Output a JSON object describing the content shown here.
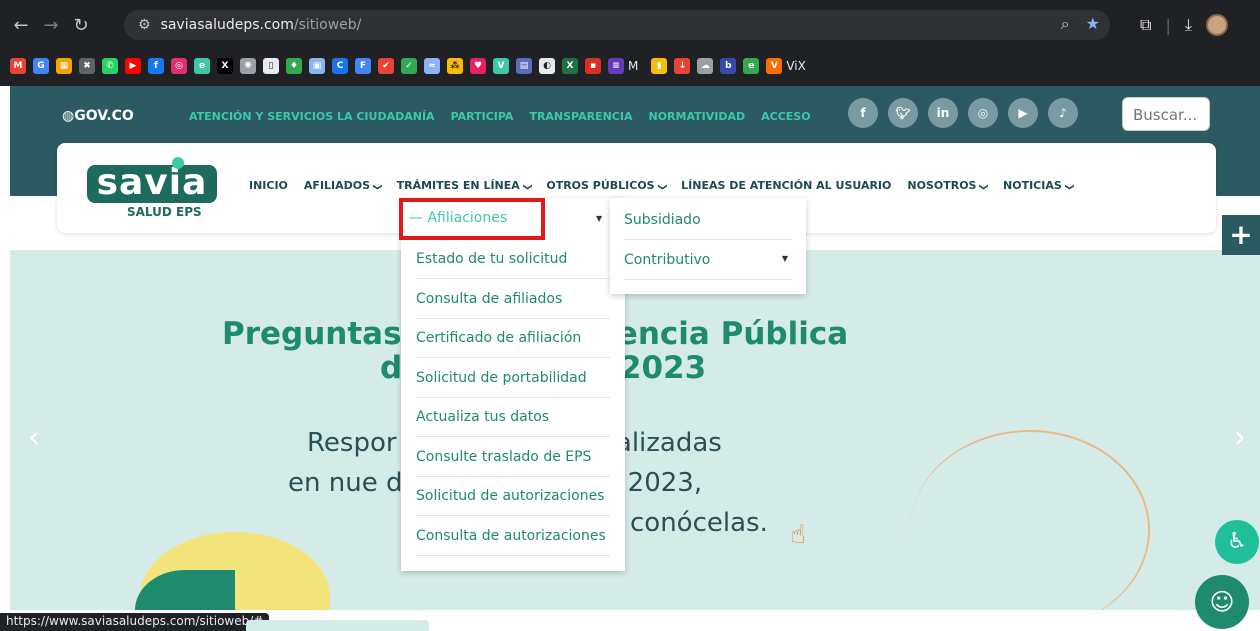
{
  "browser": {
    "url_domain": "saviasaludeps.com",
    "url_path": "/sitioweb/",
    "status_url": "https://www.saviasaludeps.com/sitioweb/#",
    "bookmarks": [
      {
        "icon": "gmail-icon",
        "color": "#ea4335",
        "glyph": "M"
      },
      {
        "icon": "google-icon",
        "color": "#4285f4",
        "glyph": "G"
      },
      {
        "icon": "grid-app-icon",
        "color": "#f4a300",
        "glyph": "▦"
      },
      {
        "icon": "x-app-icon",
        "color": "#5f6368",
        "glyph": "✖"
      },
      {
        "icon": "whatsapp-icon",
        "color": "#25d366",
        "glyph": "✆"
      },
      {
        "icon": "youtube-icon",
        "color": "#ff0000",
        "glyph": "▶"
      },
      {
        "icon": "facebook-icon",
        "color": "#1877f2",
        "glyph": "f"
      },
      {
        "icon": "instagram-icon",
        "color": "#e1306c",
        "glyph": "◎"
      },
      {
        "icon": "e-app-icon",
        "color": "#3ec8a8",
        "glyph": "e"
      },
      {
        "icon": "twitter-x-icon",
        "color": "#000000",
        "glyph": "X"
      },
      {
        "icon": "gear-app-icon",
        "color": "#9aa0a6",
        "glyph": "✺"
      },
      {
        "icon": "doc-icon",
        "color": "#e8eaed",
        "glyph": "▯"
      },
      {
        "icon": "map-pin-icon",
        "color": "#34a853",
        "glyph": "♦"
      },
      {
        "icon": "photo-icon",
        "color": "#8ab4f8",
        "glyph": "▣"
      },
      {
        "icon": "c-app-icon",
        "color": "#1a73e8",
        "glyph": "C"
      },
      {
        "icon": "form-icon",
        "color": "#4285f4",
        "glyph": "F"
      },
      {
        "icon": "check-icon",
        "color": "#ea4335",
        "glyph": "✔"
      },
      {
        "icon": "tick-icon",
        "color": "#34a853",
        "glyph": "✓"
      },
      {
        "icon": "wave-icon",
        "color": "#8ab4f8",
        "glyph": "≈"
      },
      {
        "icon": "dots-app-icon",
        "color": "#fbbc04",
        "glyph": "⁂"
      },
      {
        "icon": "heart-icon",
        "color": "#e91e63",
        "glyph": "♥"
      },
      {
        "icon": "v-app-icon",
        "color": "#3ec8a8",
        "glyph": "V"
      },
      {
        "icon": "calendar-icon",
        "color": "#5c6bc0",
        "glyph": "▤"
      },
      {
        "icon": "globe-icon",
        "color": "#e8eaed",
        "glyph": "◐"
      },
      {
        "icon": "excel-icon",
        "color": "#1e7145",
        "glyph": "X"
      },
      {
        "icon": "red-app-icon",
        "color": "#d93025",
        "glyph": "▪"
      },
      {
        "icon": "list-app-icon",
        "color": "#673ab7",
        "glyph": "≡"
      }
    ],
    "bookmark_label_m": "M",
    "bookmark_label_vix": "ViX",
    "bookmarks2": [
      {
        "icon": "bars-chart-icon",
        "color": "#fbbc04",
        "glyph": "▮"
      },
      {
        "icon": "download-app-icon",
        "color": "#ea4335",
        "glyph": "↓"
      },
      {
        "icon": "cloud-app-icon",
        "color": "#9aa0a6",
        "glyph": "☁"
      },
      {
        "icon": "buk-icon",
        "color": "#3949ab",
        "glyph": "b"
      },
      {
        "icon": "green-e-icon",
        "color": "#34a853",
        "glyph": "e"
      },
      {
        "icon": "vix-icon",
        "color": "#ff6d00",
        "glyph": "V"
      }
    ]
  },
  "gov": {
    "logo": "GOV.CO",
    "links": [
      "ATENCIÓN Y SERVICIOS LA CIUDADANÍA",
      "PARTICIPA",
      "TRANSPARENCIA",
      "NORMATIVIDAD",
      "ACCESO"
    ],
    "social": [
      {
        "name": "facebook-icon",
        "glyph": "f"
      },
      {
        "name": "twitter-icon",
        "glyph": "🐦︎"
      },
      {
        "name": "linkedin-icon",
        "glyph": "in"
      },
      {
        "name": "instagram-icon",
        "glyph": "◎"
      },
      {
        "name": "youtube-icon",
        "glyph": "▶"
      },
      {
        "name": "tiktok-icon",
        "glyph": "♪"
      }
    ],
    "search_placeholder": "Buscar..."
  },
  "logo": {
    "main": "savia",
    "sub": "SALUD EPS"
  },
  "mainnav": [
    {
      "label": "INICIO",
      "active": true,
      "chev": false
    },
    {
      "label": "AFILIADOS",
      "active": false,
      "chev": true
    },
    {
      "label": "TRÁMITES EN LÍNEA",
      "active": true,
      "chev": true
    },
    {
      "label": "OTROS PÚBLICOS",
      "active": false,
      "chev": true
    },
    {
      "label": "LÍNEAS DE ATENCIÓN AL USUARIO",
      "active": false,
      "chev": false
    },
    {
      "label": "NOSOTROS",
      "active": false,
      "chev": true
    },
    {
      "label": "NOTICIAS",
      "active": false,
      "chev": true
    }
  ],
  "dropdown": {
    "highlight": "— Afiliaciones",
    "items": [
      "Estado de tu solicitud",
      "Consulta de afiliados",
      "Certificado de afiliación",
      "Solicitud de portabilidad",
      "Actualiza tus datos",
      "Consulte traslado de EPS",
      "Solicitud de autorizaciones",
      "Consulta de autorizaciones"
    ],
    "submenu": [
      "Subsidiado",
      "Contributivo"
    ]
  },
  "hero": {
    "title1": "Preguntas s de la Audiencia Pública",
    "title2": "d de Cuentas 2023",
    "text1": "Respor las preguntas realizadas",
    "text2": "en nue dición de Cuentas 2023,",
    "text3": "conócelas."
  },
  "colors": {
    "brand": "#1e6b5e",
    "accent": "#3ec8a8",
    "highlight_border": "#e01919",
    "header_bg": "#2b5a63"
  }
}
